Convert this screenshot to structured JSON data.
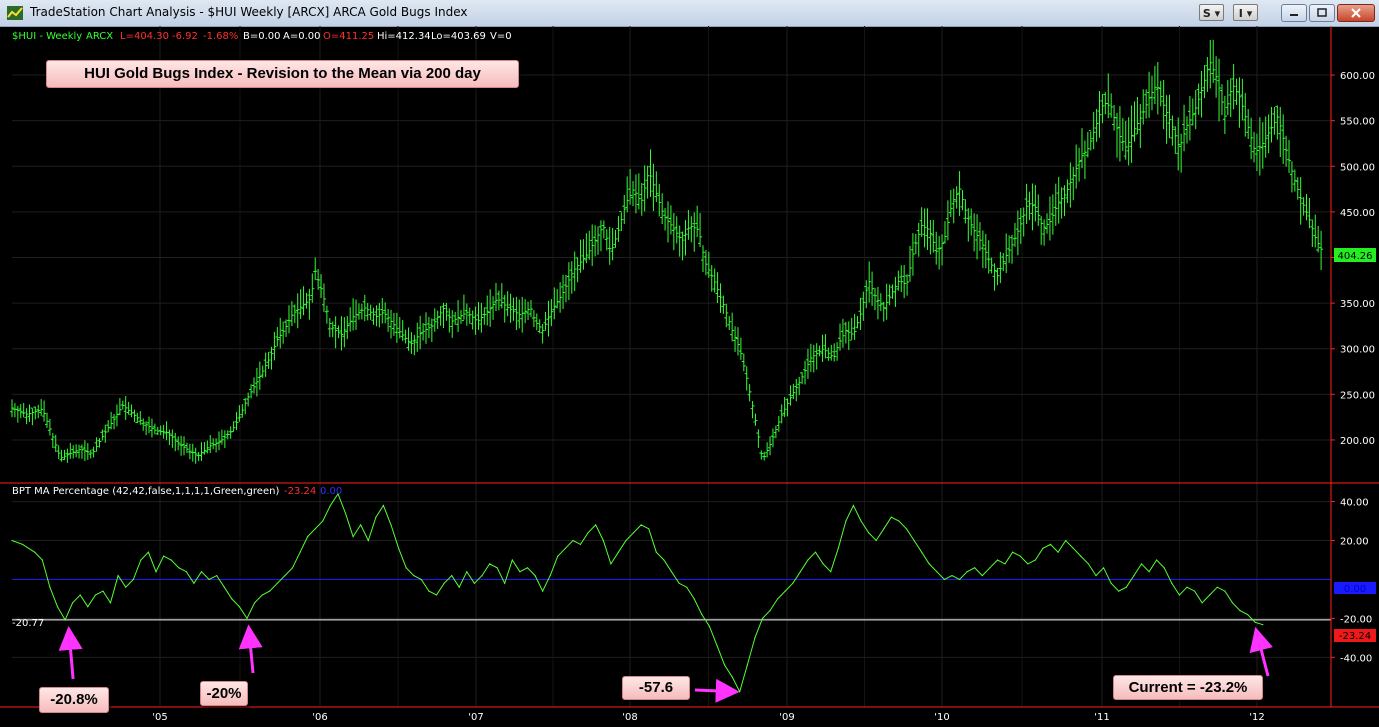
{
  "window": {
    "title": "TradeStation Chart Analysis - $HUI Weekly [ARCX] ARCA Gold Bugs Index",
    "btn_s": "S ▾",
    "btn_i": "I ▾"
  },
  "header": {
    "symbol": "$HUI - Weekly",
    "exchange": "ARCX",
    "last": "L=404.30",
    "change": "-6.92",
    "change_pct": "-1.68%",
    "bid": "B=0.00",
    "ask": "A=0.00",
    "open": "O=411.25",
    "high": "Hi=412.34",
    "low": "Lo=403.69",
    "volume": "V=0"
  },
  "annotations": {
    "title_box": "HUI Gold Bugs Index - Revision to the Mean via 200 day",
    "low_2004": "-20.8%",
    "low_2005": "-20%",
    "low_2008": "-57.6",
    "current": "Current = -23.2%"
  },
  "indicator": {
    "label": "BPT MA Percentage (42,42,false,1,1,1,1,Green,green)",
    "value": "-23.24",
    "value2": "0.00",
    "left_readout": "-20.77",
    "right_readout": "-23.24",
    "zero_readout": "0.00"
  },
  "colors": {
    "price": "#33ff33",
    "indicator": "#55ff33",
    "zero_line": "#1a1aff",
    "ref_line": "#ffffff",
    "axis": "#ff2020",
    "grid": "#1e1e1e",
    "arrow": "#ff33ff",
    "last_price_bg": "#22ee22"
  },
  "chart_data": [
    {
      "type": "ohlc",
      "title": "HUI Gold Bugs Index - Revision to the Mean via 200 day",
      "series_name": "$HUI - Weekly",
      "xlabel": "",
      "ylabel": "",
      "x_ticks": [
        "'05",
        "'06",
        "'07",
        "'08",
        "'09",
        "'10",
        "'11",
        "'12"
      ],
      "y_ticks": [
        "200.00",
        "250.00",
        "300.00",
        "350.00",
        "400.00",
        "450.00",
        "500.00",
        "550.00",
        "600.00"
      ],
      "ylim": [
        150,
        650
      ],
      "xlim": [
        2004.55,
        2012.5
      ],
      "last_value": "404.26",
      "grid": true,
      "points": [
        [
          2004.55,
          235
        ],
        [
          2004.65,
          228
        ],
        [
          2004.75,
          234
        ],
        [
          2004.8,
          212
        ],
        [
          2004.87,
          180
        ],
        [
          2004.93,
          185
        ],
        [
          2005.0,
          190
        ],
        [
          2005.08,
          185
        ],
        [
          2005.15,
          205
        ],
        [
          2005.22,
          222
        ],
        [
          2005.28,
          238
        ],
        [
          2005.35,
          228
        ],
        [
          2005.42,
          218
        ],
        [
          2005.5,
          210
        ],
        [
          2005.58,
          208
        ],
        [
          2005.65,
          196
        ],
        [
          2005.72,
          188
        ],
        [
          2005.78,
          183
        ],
        [
          2005.85,
          193
        ],
        [
          2005.92,
          198
        ],
        [
          2006.0,
          210
        ],
        [
          2006.05,
          225
        ],
        [
          2006.1,
          245
        ],
        [
          2006.17,
          265
        ],
        [
          2006.25,
          290
        ],
        [
          2006.3,
          310
        ],
        [
          2006.35,
          322
        ],
        [
          2006.4,
          338
        ],
        [
          2006.45,
          345
        ],
        [
          2006.52,
          355
        ],
        [
          2006.55,
          385
        ],
        [
          2006.6,
          360
        ],
        [
          2006.65,
          325
        ],
        [
          2006.72,
          315
        ],
        [
          2006.8,
          335
        ],
        [
          2006.88,
          345
        ],
        [
          2006.95,
          335
        ],
        [
          2007.0,
          340
        ],
        [
          2007.1,
          320
        ],
        [
          2007.18,
          305
        ],
        [
          2007.25,
          318
        ],
        [
          2007.32,
          325
        ],
        [
          2007.4,
          345
        ],
        [
          2007.45,
          330
        ],
        [
          2007.55,
          340
        ],
        [
          2007.62,
          330
        ],
        [
          2007.7,
          343
        ],
        [
          2007.75,
          355
        ],
        [
          2007.82,
          345
        ],
        [
          2007.9,
          337
        ],
        [
          2007.97,
          345
        ],
        [
          2008.0,
          330
        ],
        [
          2008.05,
          320
        ],
        [
          2008.12,
          345
        ],
        [
          2008.18,
          360
        ],
        [
          2008.25,
          385
        ],
        [
          2008.35,
          405
        ],
        [
          2008.4,
          420
        ],
        [
          2008.45,
          435
        ],
        [
          2008.5,
          405
        ],
        [
          2008.55,
          430
        ],
        [
          2008.6,
          460
        ],
        [
          2008.65,
          475
        ],
        [
          2008.7,
          460
        ],
        [
          2008.75,
          495
        ],
        [
          2008.8,
          470
        ],
        [
          2008.85,
          445
        ],
        [
          2008.9,
          435
        ],
        [
          2008.97,
          418
        ],
        [
          2009.02,
          435
        ],
        [
          2009.08,
          430
        ],
        [
          2009.12,
          395
        ],
        [
          2009.18,
          375
        ],
        [
          2009.25,
          345
        ],
        [
          2009.3,
          320
        ],
        [
          2009.35,
          300
        ],
        [
          2009.4,
          265
        ],
        [
          2009.45,
          225
        ],
        [
          2009.5,
          178
        ],
        [
          2009.55,
          195
        ],
        [
          2009.62,
          225
        ],
        [
          2009.68,
          245
        ],
        [
          2009.75,
          265
        ],
        [
          2009.82,
          290
        ],
        [
          2009.9,
          300
        ],
        [
          2009.97,
          290
        ],
        [
          2010.0,
          305
        ],
        [
          2010.05,
          320
        ],
        [
          2010.1,
          315
        ],
        [
          2010.15,
          340
        ],
        [
          2010.2,
          375
        ],
        [
          2010.25,
          355
        ],
        [
          2010.3,
          345
        ],
        [
          2010.35,
          360
        ],
        [
          2010.4,
          375
        ],
        [
          2010.45,
          370
        ],
        [
          2010.5,
          410
        ],
        [
          2010.55,
          435
        ],
        [
          2010.6,
          430
        ],
        [
          2010.65,
          405
        ],
        [
          2010.7,
          420
        ],
        [
          2010.75,
          460
        ],
        [
          2010.8,
          475
        ],
        [
          2010.85,
          445
        ],
        [
          2010.9,
          428
        ],
        [
          2010.95,
          415
        ],
        [
          2011.0,
          395
        ],
        [
          2011.05,
          380
        ],
        [
          2011.1,
          400
        ],
        [
          2011.15,
          415
        ],
        [
          2011.2,
          435
        ],
        [
          2011.25,
          460
        ],
        [
          2011.3,
          455
        ],
        [
          2011.35,
          432
        ],
        [
          2011.4,
          440
        ],
        [
          2011.45,
          460
        ],
        [
          2011.5,
          470
        ],
        [
          2011.55,
          490
        ],
        [
          2011.6,
          510
        ],
        [
          2011.65,
          520
        ],
        [
          2011.7,
          545
        ],
        [
          2011.75,
          570
        ],
        [
          2011.8,
          565
        ],
        [
          2011.85,
          535
        ],
        [
          2011.9,
          520
        ],
        [
          2011.95,
          540
        ],
        [
          2012.0,
          555
        ],
        [
          2012.05,
          575
        ],
        [
          2012.1,
          590
        ],
        [
          2012.15,
          565
        ],
        [
          2012.2,
          545
        ],
        [
          2012.25,
          520
        ],
        [
          2012.3,
          545
        ],
        [
          2012.35,
          560
        ],
        [
          2012.4,
          585
        ],
        [
          2012.45,
          615
        ],
        [
          2012.5,
          595
        ],
        [
          2012.55,
          555
        ],
        [
          2012.6,
          590
        ],
        [
          2012.65,
          575
        ],
        [
          2012.7,
          545
        ],
        [
          2012.75,
          515
        ],
        [
          2012.8,
          525
        ],
        [
          2012.85,
          540
        ],
        [
          2012.9,
          555
        ],
        [
          2012.95,
          520
        ],
        [
          2013.0,
          490
        ],
        [
          2013.05,
          465
        ],
        [
          2013.1,
          445
        ],
        [
          2013.15,
          420
        ],
        [
          2013.2,
          404.26
        ]
      ]
    },
    {
      "type": "line",
      "title": "BPT MA Percentage (42,42,false,1,1,1,1,Green,green)",
      "xlabel": "",
      "ylabel": "",
      "y_ticks": [
        "-40.00",
        "-20.00",
        "20.00",
        "40.00"
      ],
      "ylim": [
        -60,
        45
      ],
      "zero_line": 0,
      "reference_line": -20.77,
      "last_value": -23.24,
      "grid": true,
      "points": [
        [
          2004.55,
          20
        ],
        [
          2004.62,
          18
        ],
        [
          2004.7,
          14
        ],
        [
          2004.75,
          10
        ],
        [
          2004.8,
          -4
        ],
        [
          2004.85,
          -14
        ],
        [
          2004.9,
          -20.8
        ],
        [
          2004.95,
          -12
        ],
        [
          2005.0,
          -8
        ],
        [
          2005.05,
          -14
        ],
        [
          2005.1,
          -8
        ],
        [
          2005.15,
          -6
        ],
        [
          2005.2,
          -12
        ],
        [
          2005.25,
          2
        ],
        [
          2005.3,
          -4
        ],
        [
          2005.35,
          0
        ],
        [
          2005.4,
          10
        ],
        [
          2005.45,
          14
        ],
        [
          2005.5,
          4
        ],
        [
          2005.55,
          12
        ],
        [
          2005.6,
          10
        ],
        [
          2005.65,
          6
        ],
        [
          2005.7,
          4
        ],
        [
          2005.75,
          -2
        ],
        [
          2005.8,
          4
        ],
        [
          2005.85,
          0
        ],
        [
          2005.9,
          2
        ],
        [
          2005.95,
          -4
        ],
        [
          2006.0,
          -10
        ],
        [
          2006.05,
          -14
        ],
        [
          2006.1,
          -20
        ],
        [
          2006.15,
          -12
        ],
        [
          2006.2,
          -8
        ],
        [
          2006.25,
          -6
        ],
        [
          2006.3,
          -2
        ],
        [
          2006.35,
          2
        ],
        [
          2006.4,
          6
        ],
        [
          2006.45,
          14
        ],
        [
          2006.5,
          22
        ],
        [
          2006.55,
          26
        ],
        [
          2006.6,
          30
        ],
        [
          2006.65,
          38
        ],
        [
          2006.7,
          44
        ],
        [
          2006.75,
          34
        ],
        [
          2006.8,
          22
        ],
        [
          2006.85,
          28
        ],
        [
          2006.9,
          20
        ],
        [
          2006.95,
          32
        ],
        [
          2007.0,
          38
        ],
        [
          2007.05,
          28
        ],
        [
          2007.1,
          16
        ],
        [
          2007.15,
          6
        ],
        [
          2007.2,
          2
        ],
        [
          2007.25,
          0
        ],
        [
          2007.3,
          -6
        ],
        [
          2007.35,
          -8
        ],
        [
          2007.4,
          -2
        ],
        [
          2007.45,
          2
        ],
        [
          2007.5,
          -4
        ],
        [
          2007.55,
          4
        ],
        [
          2007.6,
          -2
        ],
        [
          2007.65,
          2
        ],
        [
          2007.7,
          8
        ],
        [
          2007.75,
          6
        ],
        [
          2007.8,
          -2
        ],
        [
          2007.85,
          10
        ],
        [
          2007.9,
          4
        ],
        [
          2007.95,
          6
        ],
        [
          2008.0,
          2
        ],
        [
          2008.05,
          -6
        ],
        [
          2008.1,
          2
        ],
        [
          2008.15,
          12
        ],
        [
          2008.2,
          16
        ],
        [
          2008.25,
          20
        ],
        [
          2008.3,
          18
        ],
        [
          2008.35,
          24
        ],
        [
          2008.4,
          28
        ],
        [
          2008.45,
          20
        ],
        [
          2008.5,
          8
        ],
        [
          2008.55,
          14
        ],
        [
          2008.6,
          20
        ],
        [
          2008.65,
          24
        ],
        [
          2008.7,
          28
        ],
        [
          2008.75,
          26
        ],
        [
          2008.8,
          14
        ],
        [
          2008.85,
          10
        ],
        [
          2008.9,
          4
        ],
        [
          2008.95,
          -2
        ],
        [
          2009.0,
          -4
        ],
        [
          2009.05,
          -10
        ],
        [
          2009.1,
          -18
        ],
        [
          2009.15,
          -24
        ],
        [
          2009.2,
          -34
        ],
        [
          2009.25,
          -44
        ],
        [
          2009.3,
          -50
        ],
        [
          2009.35,
          -57.6
        ],
        [
          2009.4,
          -44
        ],
        [
          2009.45,
          -30
        ],
        [
          2009.5,
          -20
        ],
        [
          2009.55,
          -16
        ],
        [
          2009.6,
          -10
        ],
        [
          2009.65,
          -6
        ],
        [
          2009.7,
          -2
        ],
        [
          2009.75,
          4
        ],
        [
          2009.8,
          10
        ],
        [
          2009.85,
          14
        ],
        [
          2009.9,
          8
        ],
        [
          2009.95,
          4
        ],
        [
          2010.0,
          16
        ],
        [
          2010.05,
          30
        ],
        [
          2010.1,
          38
        ],
        [
          2010.15,
          30
        ],
        [
          2010.2,
          24
        ],
        [
          2010.25,
          20
        ],
        [
          2010.3,
          26
        ],
        [
          2010.35,
          32
        ],
        [
          2010.4,
          30
        ],
        [
          2010.45,
          26
        ],
        [
          2010.5,
          20
        ],
        [
          2010.55,
          14
        ],
        [
          2010.6,
          8
        ],
        [
          2010.65,
          4
        ],
        [
          2010.7,
          0
        ],
        [
          2010.75,
          2
        ],
        [
          2010.8,
          0
        ],
        [
          2010.85,
          4
        ],
        [
          2010.9,
          6
        ],
        [
          2010.95,
          2
        ],
        [
          2011.0,
          6
        ],
        [
          2011.05,
          10
        ],
        [
          2011.1,
          8
        ],
        [
          2011.15,
          14
        ],
        [
          2011.2,
          12
        ],
        [
          2011.25,
          8
        ],
        [
          2011.3,
          10
        ],
        [
          2011.35,
          16
        ],
        [
          2011.4,
          18
        ],
        [
          2011.45,
          14
        ],
        [
          2011.5,
          20
        ],
        [
          2011.55,
          16
        ],
        [
          2011.6,
          12
        ],
        [
          2011.65,
          8
        ],
        [
          2011.7,
          2
        ],
        [
          2011.75,
          6
        ],
        [
          2011.8,
          -2
        ],
        [
          2011.85,
          -6
        ],
        [
          2011.9,
          -4
        ],
        [
          2011.95,
          2
        ],
        [
          2012.0,
          8
        ],
        [
          2012.05,
          4
        ],
        [
          2012.1,
          10
        ],
        [
          2012.15,
          6
        ],
        [
          2012.2,
          -2
        ],
        [
          2012.25,
          -8
        ],
        [
          2012.3,
          -4
        ],
        [
          2012.35,
          -6
        ],
        [
          2012.4,
          -12
        ],
        [
          2012.45,
          -8
        ],
        [
          2012.5,
          -4
        ],
        [
          2012.55,
          -6
        ],
        [
          2012.6,
          -12
        ],
        [
          2012.65,
          -16
        ],
        [
          2012.7,
          -18
        ],
        [
          2012.75,
          -22
        ],
        [
          2012.8,
          -23.24
        ]
      ]
    }
  ]
}
